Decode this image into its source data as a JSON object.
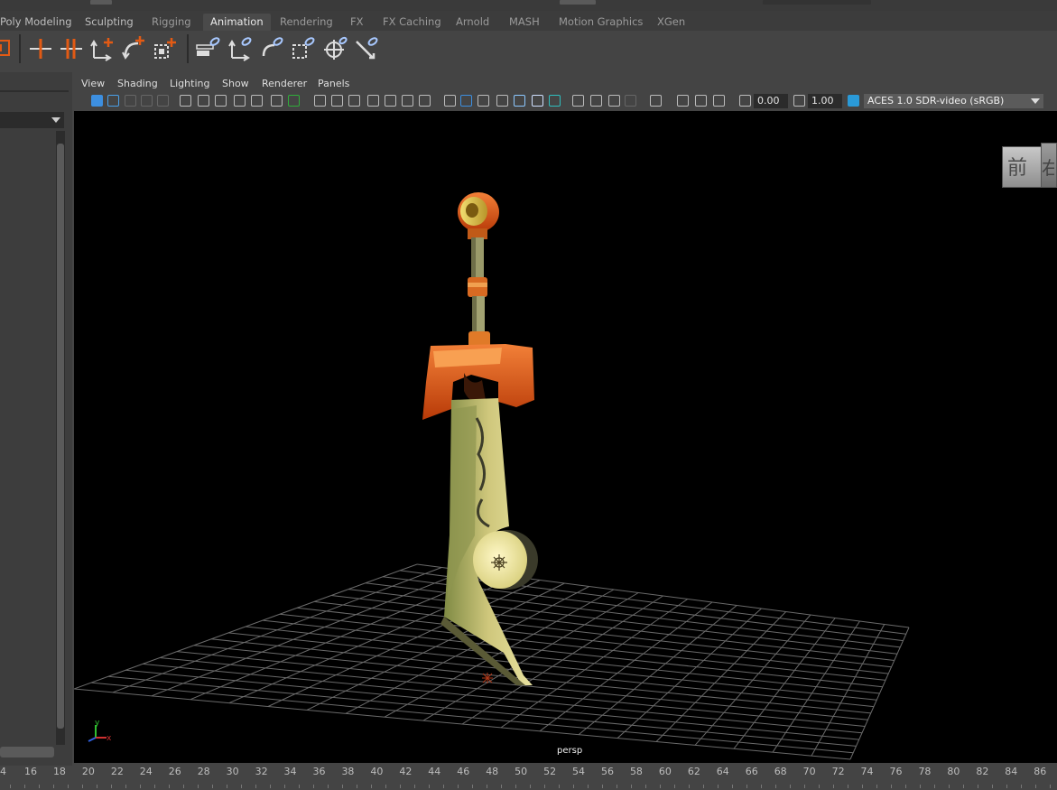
{
  "shelf": {
    "tabs": [
      {
        "label": "Poly Modeling",
        "active": false
      },
      {
        "label": "Sculpting",
        "active": false
      },
      {
        "label": "Rigging",
        "active": false
      },
      {
        "label": "Animation",
        "active": true
      },
      {
        "label": "Rendering",
        "active": false
      },
      {
        "label": "FX",
        "active": false
      },
      {
        "label": "FX Caching",
        "active": false
      },
      {
        "label": "Arnold",
        "active": false
      },
      {
        "label": "MASH",
        "active": false
      },
      {
        "label": "Motion Graphics",
        "active": false
      },
      {
        "label": "XGen",
        "active": false
      }
    ],
    "tools": [
      "set-key-icon",
      "set-breakdown-icon",
      "set-key-translate-icon",
      "set-key-rotate-icon",
      "set-key-scale-icon",
      "ik-handle-icon",
      "ik-spline-icon",
      "parent-constraint-icon",
      "orient-constraint-icon",
      "scale-constraint-icon",
      "point-constraint-icon",
      "aim-constraint-icon"
    ]
  },
  "viewport": {
    "menu": [
      "View",
      "Shading",
      "Lighting",
      "Show",
      "Renderer",
      "Panels"
    ],
    "exposure": "0.00",
    "gamma": "1.00",
    "color_space": "ACES 1.0 SDR-video (sRGB)",
    "camera_label": "persp",
    "view_cube_face": "前",
    "view_cube_side": "右",
    "axis": {
      "x": "x",
      "y": "y",
      "z": "z"
    }
  },
  "timeline": {
    "ticks": [
      "4",
      "16",
      "18",
      "20",
      "22",
      "24",
      "26",
      "28",
      "30",
      "32",
      "34",
      "36",
      "38",
      "40",
      "42",
      "44",
      "46",
      "48",
      "50",
      "52",
      "54",
      "56",
      "58",
      "60",
      "62",
      "64",
      "66",
      "68",
      "70",
      "72",
      "74",
      "76",
      "78",
      "80",
      "82",
      "84",
      "86"
    ]
  },
  "colors": {
    "sword_gold": "#d9d27a",
    "sword_orange": "#e25a14",
    "grid": "#6a6a6a",
    "background": "#000000"
  }
}
